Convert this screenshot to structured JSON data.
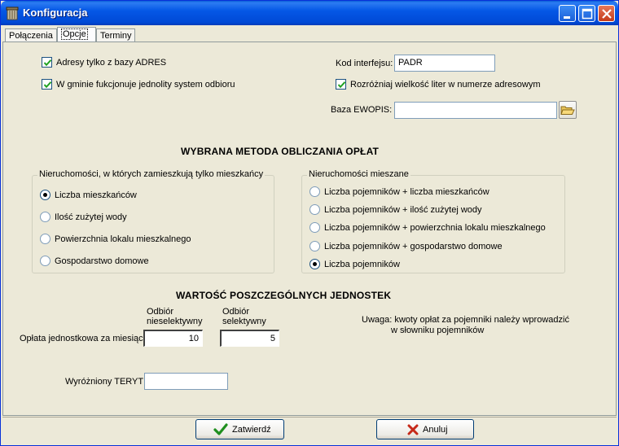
{
  "window": {
    "title": "Konfiguracja"
  },
  "tabs": [
    {
      "label": "Połączenia",
      "active": false
    },
    {
      "label": "Opcje",
      "active": true
    },
    {
      "label": "Terminy",
      "active": false
    }
  ],
  "options": {
    "adres_only_label": "Adresy tylko z bazy ADRES",
    "adres_only_checked": true,
    "single_system_label": "W gminie fukcjonuje jednolity system odbioru",
    "single_system_checked": true,
    "interface_code_label": "Kod interfejsu:",
    "interface_code_value": "PADR",
    "case_sensitive_label": "Rozróżniaj wielkość liter w numerze adresowym",
    "case_sensitive_checked": true,
    "ewopis_label": "Baza EWOPIS:",
    "ewopis_value": ""
  },
  "method": {
    "heading": "WYBRANA METODA OBLICZANIA OPŁAT",
    "residents_group": {
      "title": "Nieruchomości, w których zamieszkują tylko mieszkańcy",
      "options": [
        "Liczba mieszkańców",
        "Ilość zużytej wody",
        "Powierzchnia lokalu mieszkalnego",
        "Gospodarstwo domowe"
      ],
      "selected_index": 0
    },
    "mixed_group": {
      "title": "Nieruchomości mieszane",
      "options": [
        "Liczba pojemników + liczba mieszkańców",
        "Liczba pojemników + ilość zużytej wody",
        "Liczba pojemników + powierzchnia lokalu mieszkalnego",
        "Liczba pojemników + gospodarstwo domowe",
        "Liczba pojemników"
      ],
      "selected_index": 4
    }
  },
  "units": {
    "heading": "WARTOŚĆ POSZCZEGÓLNYCH JEDNOSTEK",
    "col1_line1": "Odbiór",
    "col1_line2": "nieselektywny",
    "col2_line1": "Odbiór",
    "col2_line2": "selektywny",
    "row_label": "Opłata jednostkowa za miesiąc",
    "nonselective_value": "10",
    "selective_value": "5",
    "note_line1": "Uwaga: kwoty opłat za pojemniki należy wprowadzić",
    "note_line2": "w słowniku pojemników",
    "teryt_label": "Wyróżniony TERYT",
    "teryt_value": ""
  },
  "buttons": {
    "confirm_label": "Zatwierdź",
    "cancel_label": "Anuluj"
  },
  "icons": {
    "app": "trash-bin-icon",
    "minimize": "minimize-icon",
    "maximize": "maximize-icon",
    "close": "close-icon",
    "browse": "folder-open-icon",
    "confirm": "green-check-icon",
    "cancel": "red-x-icon"
  },
  "colors": {
    "titlebar": "#0558e6",
    "window_bg": "#ece9d8",
    "close_button": "#c53b1a"
  }
}
